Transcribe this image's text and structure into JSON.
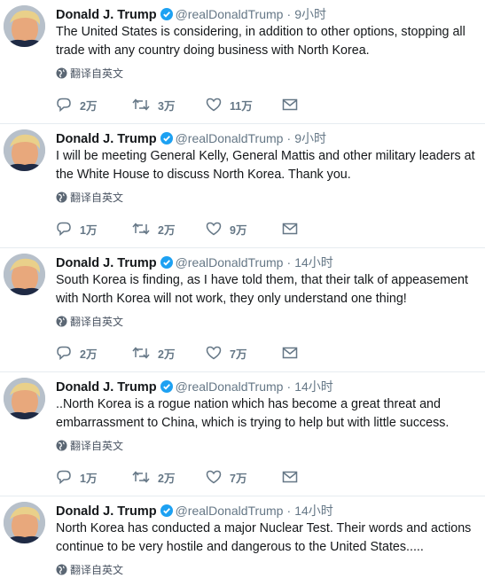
{
  "colors": {
    "verified": "#1da1f2",
    "muted": "#657786",
    "border": "#e6ecf0"
  },
  "icons": {
    "reply": "reply-icon",
    "retweet": "retweet-icon",
    "like": "heart-icon",
    "dm": "envelope-icon",
    "translate": "globe-icon",
    "verified": "verified-badge-icon"
  },
  "tweets": [
    {
      "name": "Donald J. Trump",
      "handle": "@realDonaldTrump",
      "dot": "·",
      "time": "9小时",
      "text": "The United States is considering, in addition to other options, stopping all trade with any country doing business with North Korea.",
      "translate": "翻译自英文",
      "replies": "2万",
      "retweets": "3万",
      "likes": "11万"
    },
    {
      "name": "Donald J. Trump",
      "handle": "@realDonaldTrump",
      "dot": "·",
      "time": "9小时",
      "text": "I will be meeting General Kelly, General Mattis and other military leaders at the White House to discuss North Korea. Thank you.",
      "translate": "翻译自英文",
      "replies": "1万",
      "retweets": "2万",
      "likes": "9万"
    },
    {
      "name": "Donald J. Trump",
      "handle": "@realDonaldTrump",
      "dot": "·",
      "time": "14小时",
      "text": "South Korea is finding, as I have told them, that their talk of appeasement with North Korea will not work, they only understand one thing!",
      "translate": "翻译自英文",
      "replies": "2万",
      "retweets": "2万",
      "likes": "7万"
    },
    {
      "name": "Donald J. Trump",
      "handle": "@realDonaldTrump",
      "dot": "·",
      "time": "14小时",
      "text": "..North Korea is a rogue nation which has become a great threat and embarrassment to China, which is trying to help but with little success.",
      "translate": "翻译自英文",
      "replies": "1万",
      "retweets": "2万",
      "likes": "7万"
    },
    {
      "name": "Donald J. Trump",
      "handle": "@realDonaldTrump",
      "dot": "·",
      "time": "14小时",
      "text": "North Korea has conducted a major Nuclear Test. Their words and actions continue to be very hostile and dangerous to the United States.....",
      "translate": "翻译自英文"
    }
  ]
}
